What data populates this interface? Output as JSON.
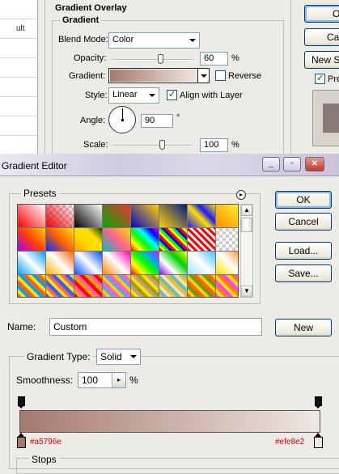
{
  "layer_style": {
    "left_list_items": [
      "ult"
    ],
    "section_title": "Gradient Overlay",
    "subsection_title": "Gradient",
    "blend_mode_label": "Blend Mode:",
    "blend_mode_value": "Color",
    "opacity_label": "Opacity:",
    "opacity_value": "60",
    "opacity_level": 60,
    "percent": "%",
    "gradient_label": "Gradient:",
    "reverse_label": "Reverse",
    "reverse_checked": false,
    "style_label": "Style:",
    "style_value": "Linear",
    "align_label": "Align with Layer",
    "align_checked": true,
    "angle_label": "Angle:",
    "angle_value": "90",
    "degree": "°",
    "scale_label": "Scale:",
    "scale_value": "100",
    "scale_level": 100,
    "buttons": {
      "ok": "O",
      "cancel": "Can",
      "new_style": "New S",
      "preview": "Pre"
    },
    "preview_checked": true
  },
  "gradient_editor": {
    "title": "Gradient Editor",
    "presets_label": "Presets",
    "ok_label": "OK",
    "cancel_label": "Cancel",
    "load_label": "Load...",
    "save_label": "Save...",
    "name_label": "Name:",
    "name_value": "Custom",
    "new_label": "New",
    "gradient_type_label": "Gradient Type:",
    "gradient_type_value": "Solid",
    "smoothness_label": "Smoothness:",
    "smoothness_value": "100",
    "percent": "%",
    "stop_left_color": "#a5796e",
    "stop_right_color": "#efe8e2",
    "stop_left_label": "#a5796e",
    "stop_right_label": "#efe8e2",
    "stops_label": "Stops"
  },
  "colors": {
    "dialog_bg": "#ecebe6",
    "gradient_start": "#a5796e",
    "gradient_end": "#efe8e2",
    "stop_label": "#d40000"
  }
}
